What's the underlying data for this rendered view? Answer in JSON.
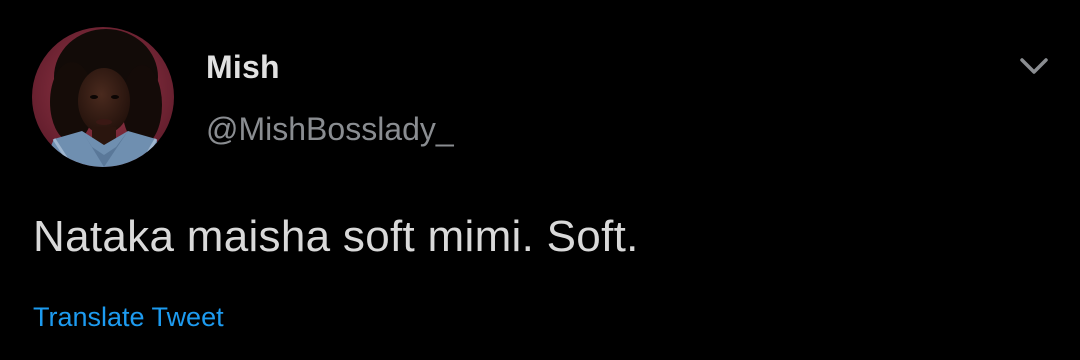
{
  "tweet": {
    "author": {
      "display_name": "Mish",
      "handle": "@MishBosslady_",
      "avatar_icon": "user-avatar"
    },
    "text": "Nataka maisha soft mimi. Soft.",
    "translate_label": "Translate Tweet",
    "menu_icon": "chevron-down-icon"
  },
  "colors": {
    "background": "#000000",
    "primary_text": "#d9d9d9",
    "secondary_text": "#8a8d91",
    "link": "#1d9bf0"
  }
}
